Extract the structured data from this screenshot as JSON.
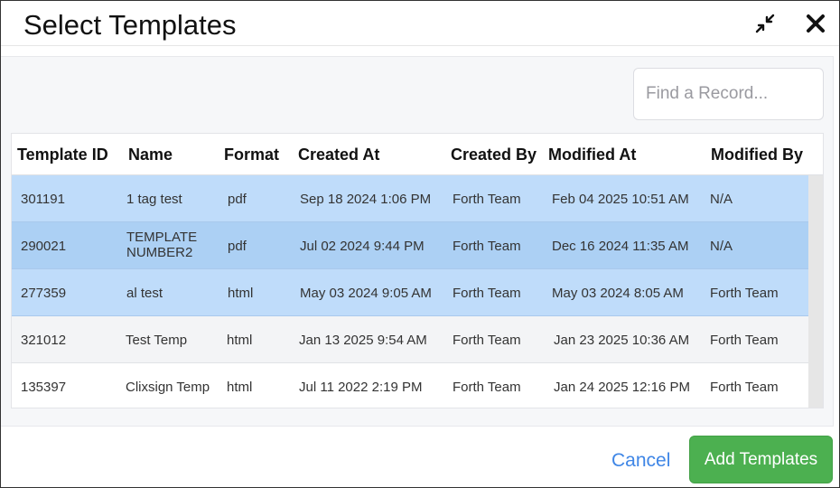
{
  "dialog": {
    "title": "Select Templates",
    "icons": {
      "minimize": "minimize-icon",
      "close": "close-icon"
    }
  },
  "search": {
    "placeholder": "Find a Record...",
    "value": ""
  },
  "table": {
    "columns": [
      "Template ID",
      "Name",
      "Format",
      "Created At",
      "Created By",
      "Modified At",
      "Modified By"
    ],
    "rows": [
      {
        "id": "301191",
        "name": "1 tag test",
        "format": "pdf",
        "created_at": "Sep 18 2024 1:06 PM",
        "created_by": "Forth Team",
        "modified_at": "Feb 04 2025 10:51 AM",
        "modified_by": "N/A",
        "selected": true
      },
      {
        "id": "290021",
        "name": "TEMPLATE NUMBER2",
        "format": "pdf",
        "created_at": "Jul 02 2024 9:44 PM",
        "created_by": "Forth Team",
        "modified_at": "Dec 16 2024 11:35 AM",
        "modified_by": "N/A",
        "selected": true
      },
      {
        "id": "277359",
        "name": "al test",
        "format": "html",
        "created_at": "May 03 2024 9:05 AM",
        "created_by": "Forth Team",
        "modified_at": "May 03 2024 8:05 AM",
        "modified_by": "Forth Team",
        "selected": true
      },
      {
        "id": "321012",
        "name": "Test Temp",
        "format": "html",
        "created_at": "Jan 13 2025 9:54 AM",
        "created_by": "Forth Team",
        "modified_at": "Jan 23 2025 10:36 AM",
        "modified_by": "Forth Team",
        "selected": false
      },
      {
        "id": "135397",
        "name": "Clixsign Temp",
        "format": "html",
        "created_at": "Jul 11 2022 2:19 PM",
        "created_by": "Forth Team",
        "modified_at": "Jan 24 2025 12:16 PM",
        "modified_by": "Forth Team",
        "selected": false
      }
    ]
  },
  "footer": {
    "cancel_label": "Cancel",
    "add_label": "Add Templates"
  },
  "colors": {
    "selected_row": "#bfdcfa",
    "primary_button": "#4cb050",
    "link": "#3f86e6"
  }
}
